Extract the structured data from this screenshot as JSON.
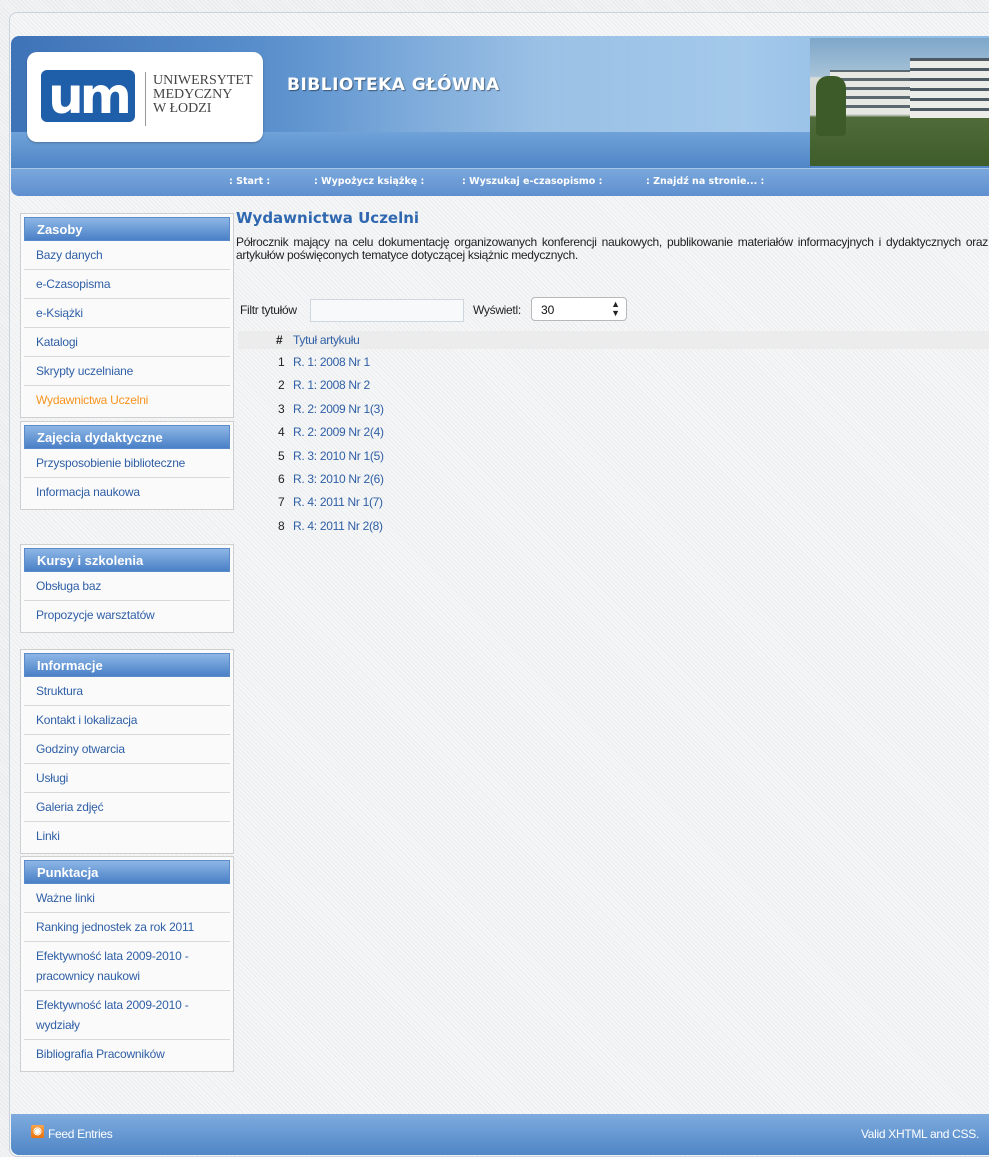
{
  "header": {
    "logo_mark": "um",
    "logo_lines": [
      "UNIWERSYTET",
      "MEDYCZNY",
      "W ŁODZI"
    ],
    "site_title": "BIBLIOTEKA GŁÓWNA"
  },
  "nav": {
    "items": [
      ": Start :",
      ": Wypożycz książkę :",
      ": Wyszukaj e-czasopismo :",
      ": Znajdź na stronie... :"
    ]
  },
  "sidebar": {
    "boxes": [
      {
        "title": "Zasoby",
        "items": [
          "Bazy danych",
          "e-Czasopisma",
          "e-Książki",
          "Katalogi",
          "Skrypty uczelniane",
          "Wydawnictwa Uczelni"
        ],
        "active_index": 5
      },
      {
        "title": "Zajęcia dydaktyczne",
        "items": [
          "Przysposobienie biblioteczne",
          "Informacja naukowa"
        ]
      },
      {
        "title": "Kursy i szkolenia",
        "items": [
          "Obsługa baz",
          "Propozycje warsztatów"
        ]
      },
      {
        "title": "Informacje",
        "items": [
          "Struktura",
          "Kontakt i lokalizacja",
          "Godziny otwarcia",
          "Usługi",
          "Galeria zdjęć",
          "Linki"
        ]
      },
      {
        "title": "Punktacja",
        "items": [
          "Ważne linki",
          "Ranking jednostek za rok 2011",
          "Efektywność lata 2009-2010 - pracownicy naukowi",
          "Efektywność lata 2009-2010 - wydziały",
          "Bibliografia Pracowników"
        ]
      }
    ]
  },
  "main": {
    "title": "Wydawnictwa Uczelni",
    "intro": "Półrocznik mający na celu dokumentację organizowanych konferencji naukowych, publikowanie materiałów informacyjnych i dydaktycznych oraz artykułów poświęconych tematyce dotyczącej książnic medycznych.",
    "filter_label": "Filtr tytułów",
    "filter_value": "",
    "show_label": "Wyświetl:",
    "show_value": "30",
    "table": {
      "headers": [
        "#",
        "Tytuł artykułu"
      ],
      "rows": [
        {
          "num": "1",
          "title": "R. 1: 2008 Nr 1"
        },
        {
          "num": "2",
          "title": "R. 1: 2008 Nr 2"
        },
        {
          "num": "3",
          "title": "R. 2: 2009 Nr 1(3)"
        },
        {
          "num": "4",
          "title": "R. 2: 2009 Nr 2(4)"
        },
        {
          "num": "5",
          "title": "R. 3: 2010 Nr 1(5)"
        },
        {
          "num": "6",
          "title": "R. 3: 2010 Nr 2(6)"
        },
        {
          "num": "7",
          "title": "R. 4: 2011 Nr 1(7)"
        },
        {
          "num": "8",
          "title": "R. 4: 2011 Nr 2(8)"
        }
      ]
    }
  },
  "footer": {
    "feed_icon": "rss-icon",
    "feed_label": "Feed Entries",
    "valid_label": "Valid XHTML and CSS."
  }
}
